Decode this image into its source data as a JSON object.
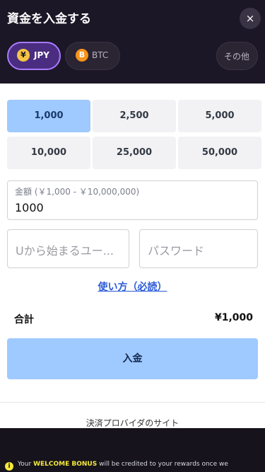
{
  "header": {
    "title": "資金を入金する",
    "close_icon": "×"
  },
  "currency_tabs": [
    {
      "label": "JPY",
      "icon": "yen-coin-icon",
      "glyph": "¥",
      "selected": true
    },
    {
      "label": "BTC",
      "icon": "bitcoin-coin-icon",
      "glyph": "B",
      "selected": false
    },
    {
      "label": "その他",
      "selected": false
    }
  ],
  "amounts": [
    {
      "label": "1,000",
      "selected": true
    },
    {
      "label": "2,500",
      "selected": false
    },
    {
      "label": "5,000",
      "selected": false
    },
    {
      "label": "10,000",
      "selected": false
    },
    {
      "label": "25,000",
      "selected": false
    },
    {
      "label": "50,000",
      "selected": false
    }
  ],
  "amount_field": {
    "label": "金額 (￥1,000 - ￥10,000,000)",
    "value": "1000"
  },
  "user_field": {
    "placeholder": "Uから始まるユー..."
  },
  "password_field": {
    "placeholder": "パスワード"
  },
  "howto_link": "使い方（必読）",
  "total": {
    "label": "合計",
    "value": "¥1,000"
  },
  "deposit_button": "入金",
  "provider_text": "決済プロバイダのサイト",
  "footer": {
    "info_icon": "i",
    "text_prefix": "Your ",
    "bonus": "WELCOME BONUS",
    "text_suffix": " will be credited to your rewards once we"
  },
  "colors": {
    "header_bg": "#1c1726",
    "accent": "#9fcaff",
    "selected_tab_border": "#a87bff",
    "bonus": "#f5e93a"
  }
}
